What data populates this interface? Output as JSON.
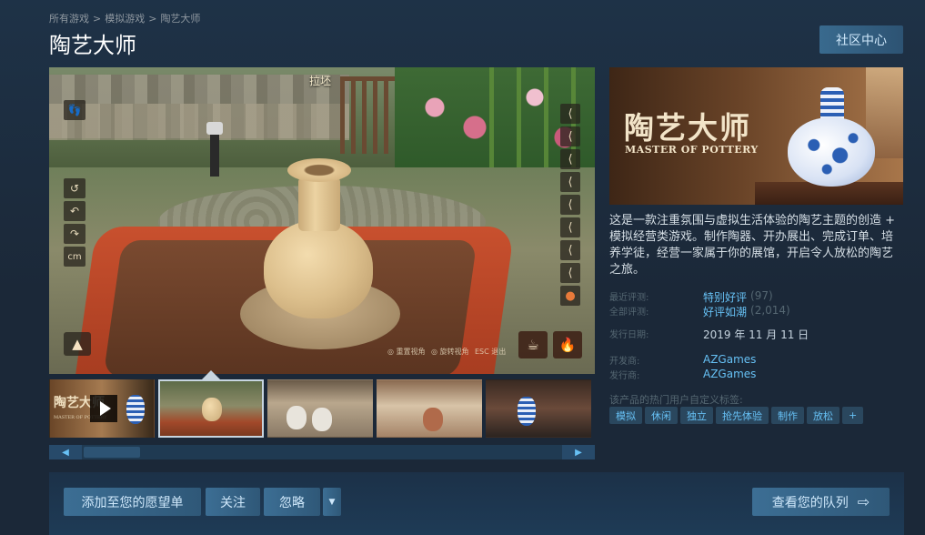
{
  "breadcrumb": {
    "items": [
      "所有游戏",
      "模拟游戏",
      "陶艺大师"
    ],
    "sep": ">"
  },
  "page_title": "陶艺大师",
  "community_button": "社区中心",
  "main_view": {
    "scene_label": "拉坯",
    "left_tools": [
      "↺",
      "↶",
      "↷",
      "cm"
    ],
    "right_tools": [
      "⟨",
      "⟨",
      "⟨",
      "⟨",
      "⟨",
      "⟨",
      "⟨",
      "⟨",
      "●"
    ],
    "hints": [
      "重置视角",
      "旋转视角",
      "退出"
    ],
    "esc_key": "ESC"
  },
  "capsule": {
    "title": "陶艺大师",
    "subtitle": "MASTER OF POTTERY"
  },
  "thumbnail_title": "陶艺大师",
  "thumbnail_subtitle": "MASTER OF POTTERY",
  "description": "这是一款注重氛围与虚拟生活体验的陶艺主题的创造 + 模拟经营类游戏。制作陶器、开办展出、完成订单、培养学徒，经营一家属于你的展馆，开启令人放松的陶艺之旅。",
  "reviews": {
    "recent_label": "最近评测:",
    "recent_value": "特别好评",
    "recent_count": "(97)",
    "all_label": "全部评测:",
    "all_value": "好评如潮",
    "all_count": "(2,014)"
  },
  "release": {
    "label": "发行日期:",
    "value": "2019 年 11 月 11 日"
  },
  "developer": {
    "label": "开发商:",
    "value": "AZGames"
  },
  "publisher": {
    "label": "发行商:",
    "value": "AZGames"
  },
  "tags_label": "该产品的热门用户自定义标签:",
  "tags": [
    "模拟",
    "休闲",
    "独立",
    "抢先体验",
    "制作",
    "放松",
    "+"
  ],
  "actions": {
    "wishlist": "添加至您的愿望单",
    "follow": "关注",
    "ignore": "忽略",
    "dropdown": "▼",
    "queue": "查看您的队列",
    "queue_arrow": "⇨"
  },
  "scroll": {
    "left": "◀",
    "right": "▶"
  },
  "colors": {
    "accent": "#67c1f5",
    "background": "#1b2838",
    "button": "#2a475e"
  }
}
